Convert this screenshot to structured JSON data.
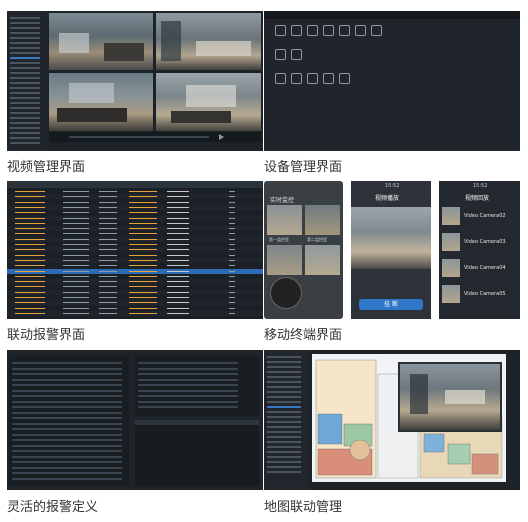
{
  "captions": [
    "视频管理界面",
    "设备管理界面",
    "联动报警界面",
    "移动终端界面",
    "灵活的报警定义",
    "地图联动管理"
  ],
  "device_icons": [
    "settings-icon",
    "user-icon",
    "device-icon",
    "network-icon",
    "record-icon",
    "alarm-icon",
    "display-icon",
    "gear-icon",
    "shield-icon",
    "server-icon",
    "storage-icon",
    "camera-icon",
    "disk-icon",
    "monitor-icon"
  ],
  "mobile": {
    "status_time_1": "15:52",
    "status_time_2": "15:52",
    "screen1_title": "实时监控",
    "screen1_cells": [
      "第一监控室",
      "第二监控室"
    ],
    "screen2_title": "视频播放",
    "screen2_button": "挂 断",
    "screen3_title": "视频回放",
    "screen3_items": [
      "Video Camera02",
      "Video Camera03",
      "Video Camera04",
      "Video Camera05"
    ]
  },
  "colors": {
    "accent": "#2f78c9",
    "highlight": "#e8a23a",
    "dark": "#1d2228"
  }
}
